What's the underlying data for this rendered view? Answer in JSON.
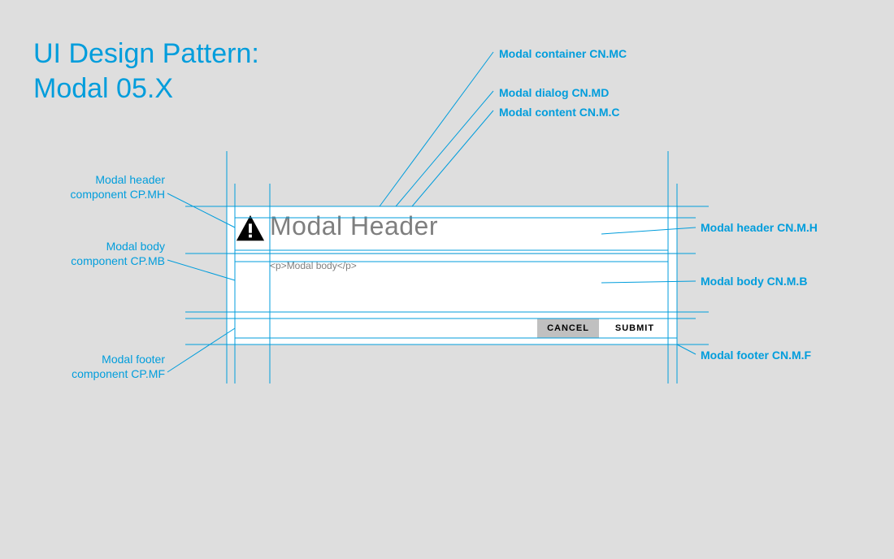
{
  "title": {
    "line1": "UI Design Pattern:",
    "line2": "Modal 05.X"
  },
  "modal": {
    "header_text": "Modal Header",
    "body_text": "<p>Modal body</p>",
    "cancel_label": "CANCEL",
    "submit_label": "SUBMIT"
  },
  "annotations": {
    "left": {
      "header": {
        "l1": "Modal header",
        "l2": "component CP.MH"
      },
      "body": {
        "l1": "Modal body",
        "l2": "component CP.MB"
      },
      "footer": {
        "l1": "Modal footer",
        "l2": "component CP.MF"
      }
    },
    "topRight": {
      "container": "Modal container CN.MC",
      "dialog": "Modal dialog CN.MD",
      "content": "Modal content CN.M.C"
    },
    "right": {
      "header": "Modal header CN.M.H",
      "body": "Modal body CN.M.B",
      "footer": "Modal footer CN.M.F"
    }
  },
  "colors": {
    "accent": "#009DDC",
    "bg": "#DEDEDE",
    "modal_bg": "#FFFFFF",
    "text_muted": "#7F7F7F",
    "btn_cancel_bg": "#C0C0C0"
  }
}
